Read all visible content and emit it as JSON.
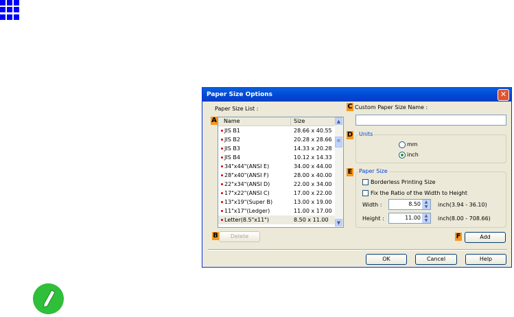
{
  "dialog": {
    "title": "Paper Size Options",
    "close": "✕"
  },
  "labels": {
    "A": "A",
    "B": "B",
    "C": "C",
    "D": "D",
    "E": "E",
    "F": "F"
  },
  "list": {
    "label": "Paper Size List :",
    "headers": [
      "Name",
      "Size"
    ],
    "rows": [
      {
        "name": "JIS B1",
        "size": "28.66 x 40.55"
      },
      {
        "name": "JIS B2",
        "size": "20.28 x 28.66"
      },
      {
        "name": "JIS B3",
        "size": "14.33 x 20.28"
      },
      {
        "name": "JIS B4",
        "size": "10.12 x 14.33"
      },
      {
        "name": "34\"x44\"(ANSI E)",
        "size": "34.00 x 44.00"
      },
      {
        "name": "28\"x40\"(ANSI F)",
        "size": "28.00 x 40.00"
      },
      {
        "name": "22\"x34\"(ANSI D)",
        "size": "22.00 x 34.00"
      },
      {
        "name": "17\"x22\"(ANSI C)",
        "size": "17.00 x 22.00"
      },
      {
        "name": "13\"x19\"(Super B)",
        "size": "13.00 x 19.00"
      },
      {
        "name": "11\"x17\"(Ledger)",
        "size": "11.00 x 17.00"
      },
      {
        "name": "Letter(8.5\"x11\")",
        "size": "8.50 x 11.00"
      }
    ]
  },
  "delete_label": "Delete",
  "custom_name": {
    "label": "Custom Paper Size Name :",
    "value": ""
  },
  "units": {
    "label": "Units",
    "mm": "mm",
    "inch": "inch",
    "selected": "inch"
  },
  "paper_size": {
    "label": "Paper Size",
    "borderless": "Borderless Printing Size",
    "fix_ratio": "Fix the Ratio of the Width to Height",
    "width_label": "Width :",
    "width": "8.50",
    "width_range": "inch(3.94 - 36.10)",
    "height_label": "Height :",
    "height": "11.00",
    "height_range": "inch(8.00 - 708.66)"
  },
  "add_label": "Add",
  "ok_label": "OK",
  "cancel_label": "Cancel",
  "help_label": "Help"
}
